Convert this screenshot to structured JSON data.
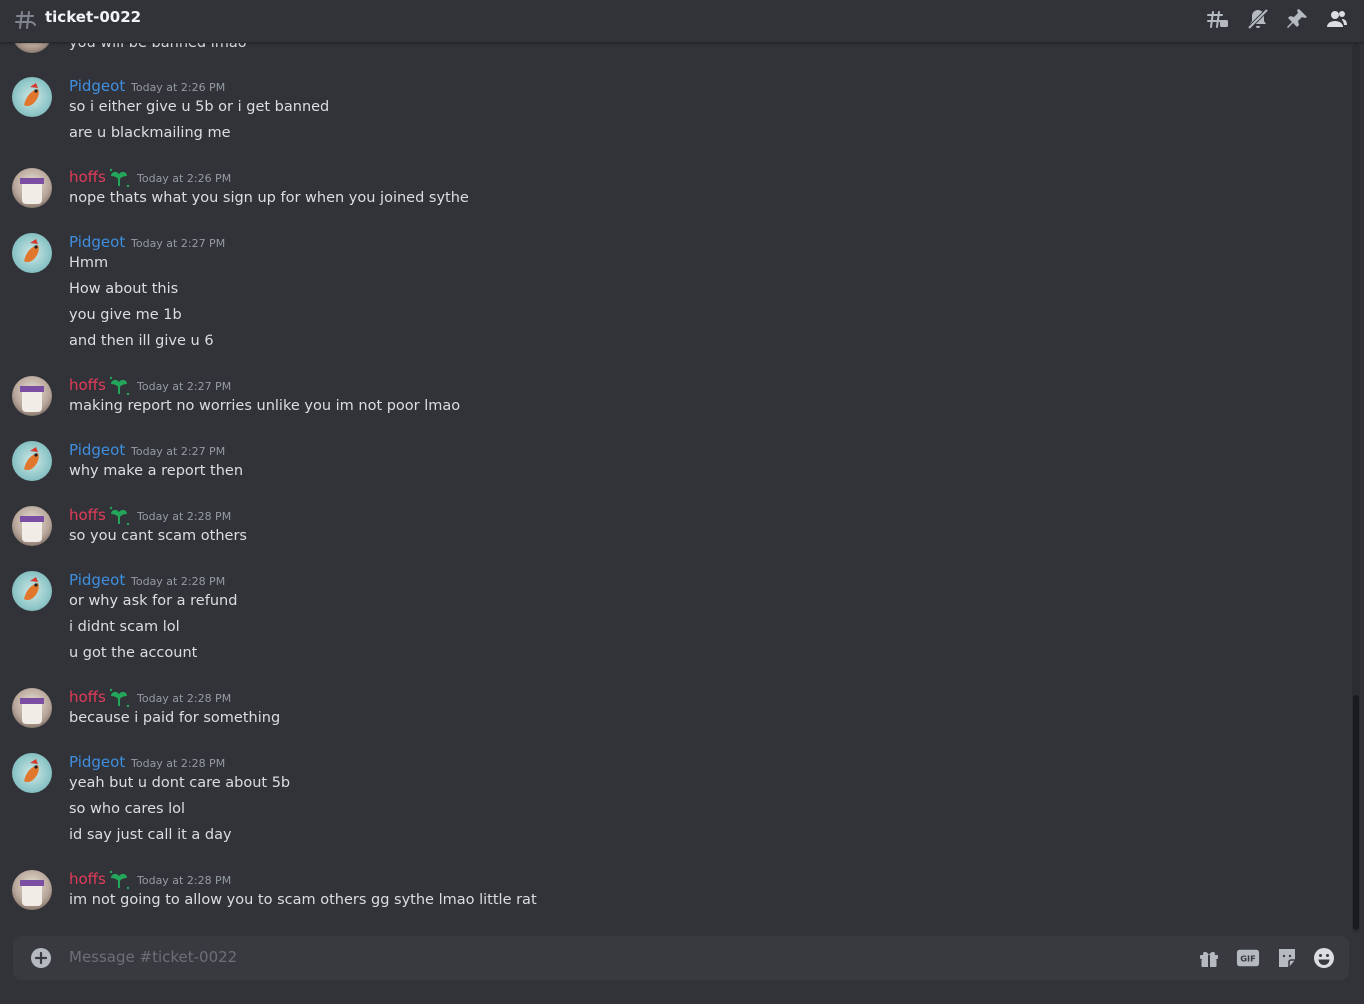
{
  "channel": {
    "name": "ticket-0022"
  },
  "header_icons": [
    "threads-icon",
    "mute-notifications-icon",
    "pin-icon",
    "member-list-icon"
  ],
  "partial_message": {
    "text": "you will be banned lmao"
  },
  "messages": [
    {
      "author": "Pidgeot",
      "timestamp": "Today at 2:26 PM",
      "lines": [
        "so i either give u 5b or i get banned",
        "are u blackmailing me"
      ]
    },
    {
      "author": "hoffs",
      "timestamp": "Today at 2:26 PM",
      "lines": [
        "nope thats what you sign up for when you joined sythe"
      ]
    },
    {
      "author": "Pidgeot",
      "timestamp": "Today at 2:27 PM",
      "lines": [
        "Hmm",
        "How about this",
        "you give me 1b",
        "and then ill give u 6"
      ]
    },
    {
      "author": "hoffs",
      "timestamp": "Today at 2:27 PM",
      "lines": [
        "making report no worries unlike you im not poor lmao"
      ]
    },
    {
      "author": "Pidgeot",
      "timestamp": "Today at 2:27 PM",
      "lines": [
        "why make a report then"
      ]
    },
    {
      "author": "hoffs",
      "timestamp": "Today at 2:28 PM",
      "lines": [
        "so you cant scam others"
      ]
    },
    {
      "author": "Pidgeot",
      "timestamp": "Today at 2:28 PM",
      "lines": [
        "or why ask for a refund",
        "i didnt scam lol",
        "u got the account"
      ]
    },
    {
      "author": "hoffs",
      "timestamp": "Today at 2:28 PM",
      "lines": [
        "because i paid for something"
      ]
    },
    {
      "author": "Pidgeot",
      "timestamp": "Today at 2:28 PM",
      "lines": [
        "yeah but u dont care about 5b",
        "so who cares lol",
        "id say just call it a day"
      ]
    },
    {
      "author": "hoffs",
      "timestamp": "Today at 2:28 PM",
      "lines": [
        "im not going to allow you to scam others gg sythe lmao little rat"
      ]
    }
  ],
  "composer": {
    "placeholder": "Message #ticket-0022",
    "gif_label": "GIF"
  },
  "colors": {
    "pidgeot_name": "#3f8fe0",
    "hoffs_name": "#e23b5a",
    "badge": "#23a55a",
    "background": "#313338"
  }
}
